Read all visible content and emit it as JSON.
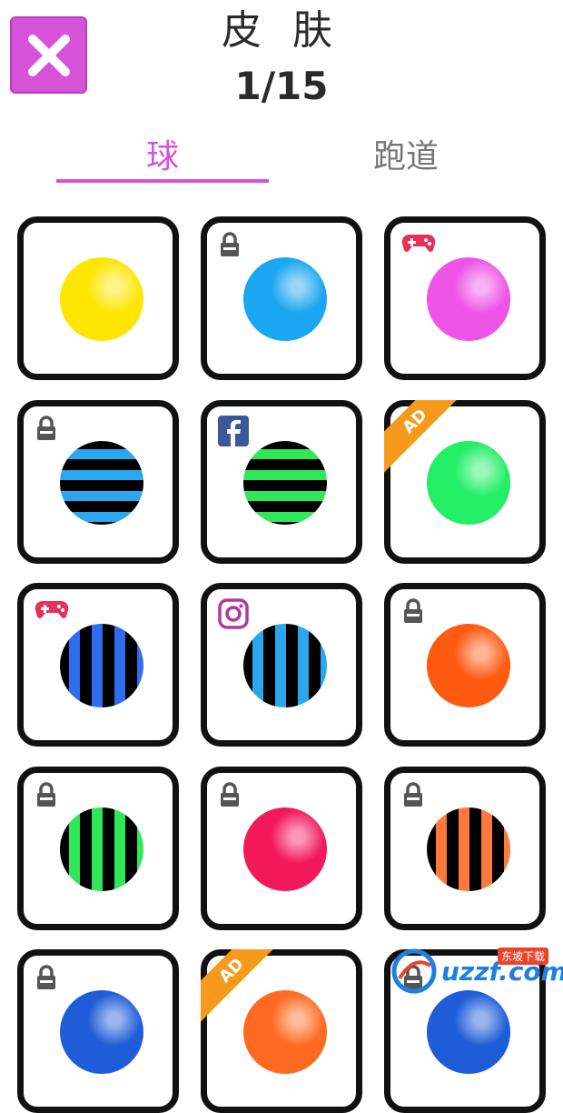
{
  "header": {
    "title": "皮 肤",
    "counter": "1/15"
  },
  "tabs": [
    {
      "label": "球",
      "active": true
    },
    {
      "label": "跑道",
      "active": false
    }
  ],
  "colors": {
    "accent": "#d653d9",
    "card_border": "#111111",
    "ad_ribbon": "#f59a1b"
  },
  "skins": [
    {
      "badge": null,
      "ad": false,
      "ball": "solid",
      "colors": [
        "#ffe600"
      ]
    },
    {
      "badge": "lock-icon",
      "ad": false,
      "ball": "solid",
      "colors": [
        "#1aa6f0"
      ]
    },
    {
      "badge": "gamepad-icon",
      "ad": false,
      "ball": "solid",
      "colors": [
        "#ee55e6"
      ]
    },
    {
      "badge": "lock-icon",
      "ad": false,
      "ball": "hstripe",
      "colors": [
        "#2aa7ee",
        "#000000"
      ]
    },
    {
      "badge": "facebook-icon",
      "ad": false,
      "ball": "hstripe",
      "colors": [
        "#2ee85a",
        "#000000"
      ]
    },
    {
      "badge": null,
      "ad": true,
      "ball": "solid",
      "colors": [
        "#22ee66"
      ]
    },
    {
      "badge": "gamepad-icon",
      "ad": false,
      "ball": "vstripe",
      "colors": [
        "#2f6cf0",
        "#000000"
      ]
    },
    {
      "badge": "instagram-icon",
      "ad": false,
      "ball": "vstripe",
      "colors": [
        "#2aa7ee",
        "#000000"
      ]
    },
    {
      "badge": "lock-icon",
      "ad": false,
      "ball": "solid",
      "colors": [
        "#ff5a12"
      ]
    },
    {
      "badge": "lock-icon",
      "ad": false,
      "ball": "vstripe",
      "colors": [
        "#2ee85a",
        "#000000"
      ]
    },
    {
      "badge": "lock-icon",
      "ad": false,
      "ball": "solid",
      "colors": [
        "#f2195a"
      ]
    },
    {
      "badge": "lock-icon",
      "ad": false,
      "ball": "vstripe",
      "colors": [
        "#ff7a3a",
        "#000000"
      ]
    },
    {
      "badge": "lock-icon",
      "ad": false,
      "ball": "solid",
      "colors": [
        "#1e5cd8"
      ]
    },
    {
      "badge": null,
      "ad": true,
      "ball": "solid",
      "colors": [
        "#ff6a20"
      ]
    },
    {
      "badge": "lock-icon",
      "ad": false,
      "ball": "solid",
      "colors": [
        "#1e5cd8"
      ]
    }
  ],
  "ad_label": "AD",
  "watermark": {
    "text": "uzzf.com",
    "sub": "东坡下载"
  }
}
